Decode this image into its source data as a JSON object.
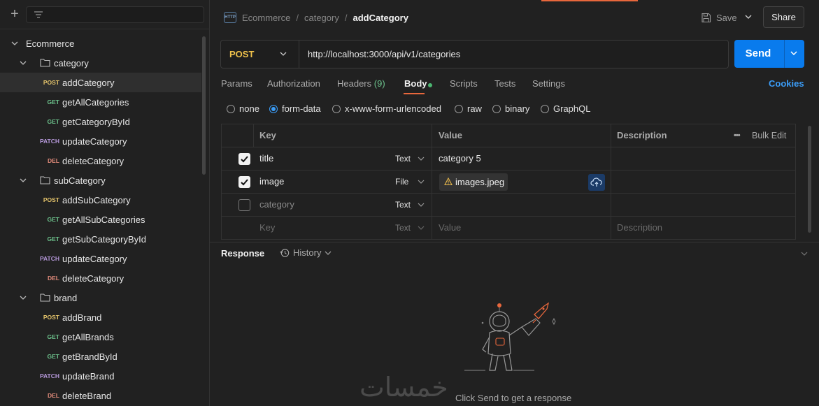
{
  "sidebar": {
    "collection": "Ecommerce",
    "folders": [
      {
        "name": "category",
        "requests": [
          {
            "method": "POST",
            "name": "addCategory",
            "selected": true
          },
          {
            "method": "GET",
            "name": "getAllCategories"
          },
          {
            "method": "GET",
            "name": "getCategoryById"
          },
          {
            "method": "PATCH",
            "name": "updateCategory"
          },
          {
            "method": "DEL",
            "name": "deleteCategory"
          }
        ]
      },
      {
        "name": "subCategory",
        "requests": [
          {
            "method": "POST",
            "name": "addSubCategory"
          },
          {
            "method": "GET",
            "name": "getAllSubCategories"
          },
          {
            "method": "GET",
            "name": "getSubCategoryById"
          },
          {
            "method": "PATCH",
            "name": "updateCategory"
          },
          {
            "method": "DEL",
            "name": "deleteCategory"
          }
        ]
      },
      {
        "name": "brand",
        "requests": [
          {
            "method": "POST",
            "name": "addBrand"
          },
          {
            "method": "GET",
            "name": "getAllBrands"
          },
          {
            "method": "GET",
            "name": "getBrandById"
          },
          {
            "method": "PATCH",
            "name": "updateBrand"
          },
          {
            "method": "DEL",
            "name": "deleteBrand"
          }
        ]
      }
    ]
  },
  "header": {
    "http_icon": "HTTP",
    "breadcrumb": [
      "Ecommerce",
      "category"
    ],
    "separator": "/",
    "current": "addCategory",
    "save_label": "Save",
    "share_label": "Share"
  },
  "request": {
    "method": "POST",
    "url": "http://localhost:3000/api/v1/categories",
    "send_label": "Send"
  },
  "tabs": {
    "params": "Params",
    "authorization": "Authorization",
    "headers": "Headers",
    "headers_count": "(9)",
    "body": "Body",
    "scripts": "Scripts",
    "tests": "Tests",
    "settings": "Settings",
    "cookies": "Cookies"
  },
  "body_types": {
    "options": [
      "none",
      "form-data",
      "x-www-form-urlencoded",
      "raw",
      "binary",
      "GraphQL"
    ],
    "selected": "form-data"
  },
  "form_table": {
    "headers": {
      "key": "Key",
      "value": "Value",
      "description": "Description",
      "bulk_edit": "Bulk Edit"
    },
    "rows": [
      {
        "checked": true,
        "key": "title",
        "type": "Text",
        "value": "category 5"
      },
      {
        "checked": true,
        "key": "image",
        "type": "File",
        "value": "images.jpeg"
      },
      {
        "checked": false,
        "key": "category",
        "type": "Text",
        "value": ""
      }
    ],
    "placeholder": {
      "key": "Key",
      "type": "Text",
      "value": "Value",
      "description": "Description"
    }
  },
  "response": {
    "label": "Response",
    "history_label": "History",
    "empty_text": "Click Send to get a response"
  },
  "watermark": "خمسات",
  "colors": {
    "accent": "#e8673c",
    "send": "#097bed",
    "post": "#e2c26a",
    "get": "#6cc08b",
    "patch": "#b497d8",
    "del": "#e08a7a",
    "link": "#3b9df8"
  }
}
